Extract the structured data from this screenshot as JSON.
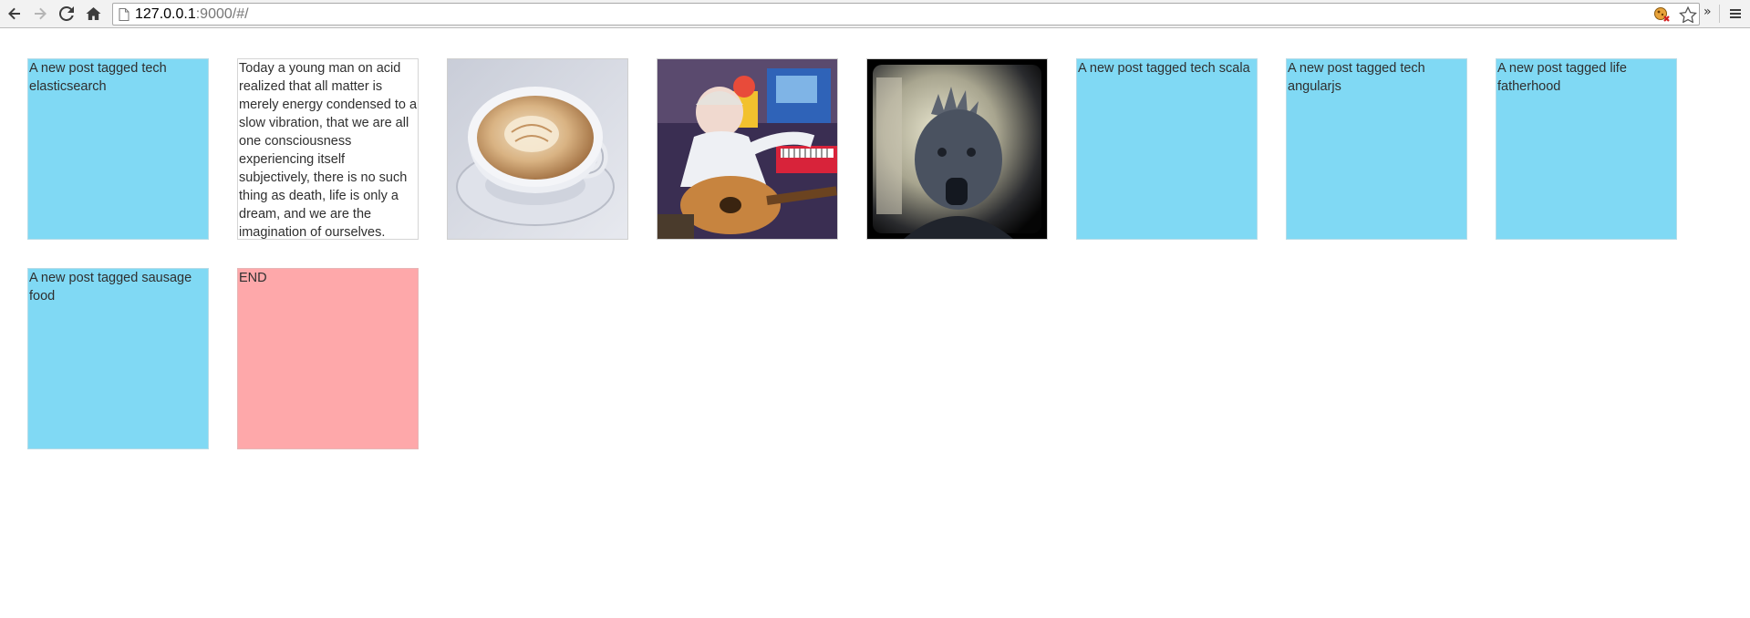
{
  "browser": {
    "url_host": "127.0.0.1",
    "url_rest": ":9000/#/",
    "icons": {
      "back": "back-arrow-icon",
      "forward": "forward-arrow-icon",
      "reload": "reload-icon",
      "home": "home-icon",
      "page": "page-icon",
      "extension": "extension-icon",
      "bookmark": "star-icon",
      "overflow": "chevron-double-right-icon",
      "menu": "hamburger-menu-icon"
    },
    "overflow_glyph": "»"
  },
  "colors": {
    "tile_blue": "#80d9f4",
    "tile_end": "#fea8aa",
    "tile_text_bg": "#ffffff"
  },
  "posts": [
    {
      "type": "tag",
      "text": "A new post tagged tech elasticsearch"
    },
    {
      "type": "quote",
      "text": "Today a young man on acid realized that all matter is merely energy condensed to a slow vibration, that we are all one consciousness experiencing itself subjectively, there is no such thing as death, life is only a dream, and we are the imagination of ourselves."
    },
    {
      "type": "image",
      "subject": "cup of coffee with latte art"
    },
    {
      "type": "image",
      "subject": "toddler playing guitar with toys"
    },
    {
      "type": "image",
      "subject": "baby portrait with dark vignette"
    },
    {
      "type": "tag",
      "text": "A new post tagged tech scala"
    },
    {
      "type": "tag",
      "text": "A new post tagged tech angularjs"
    },
    {
      "type": "tag",
      "text": "A new post tagged life fatherhood"
    },
    {
      "type": "tag",
      "text": "A new post tagged sausage food"
    },
    {
      "type": "end",
      "text": "END"
    }
  ]
}
